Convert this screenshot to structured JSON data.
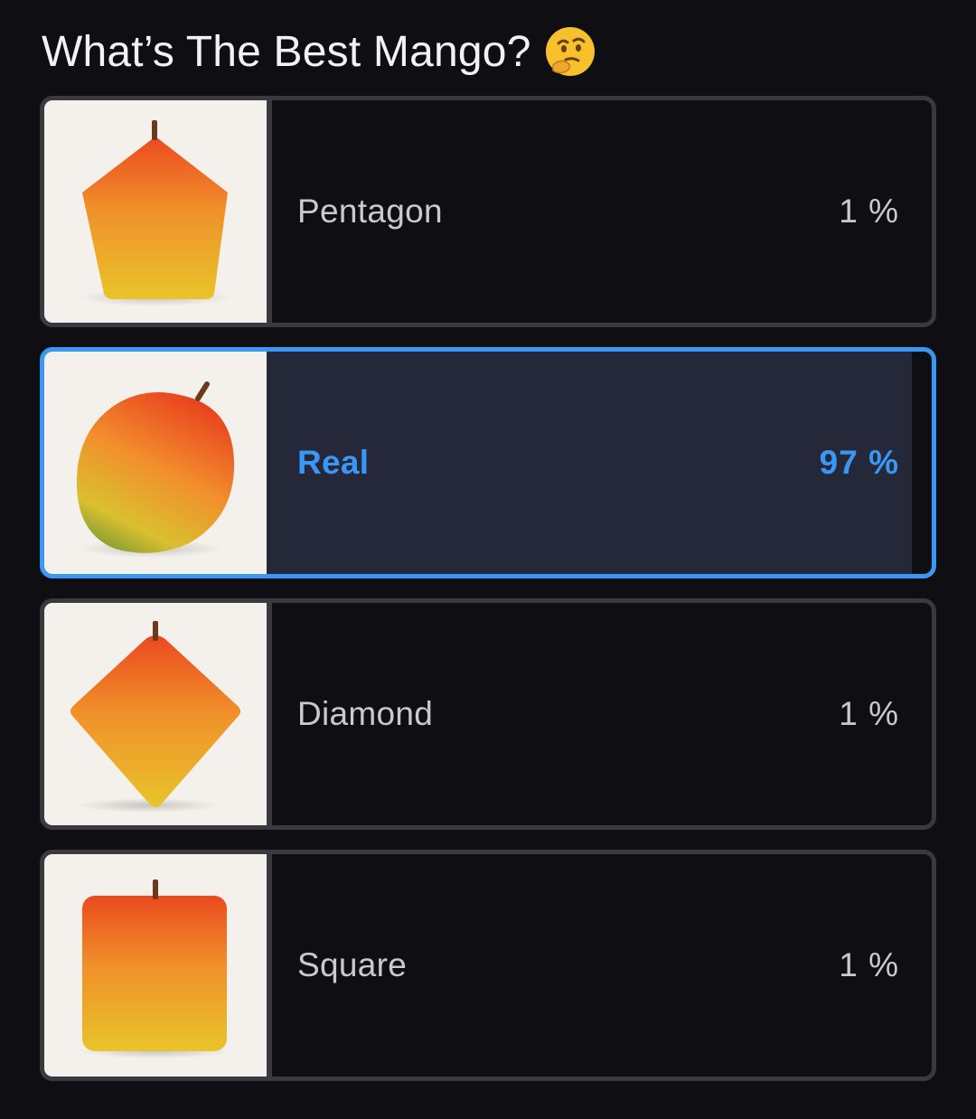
{
  "poll": {
    "title": "What’s The Best Mango?",
    "title_emoji": "thinking-face-icon",
    "accent_color": "#3b97f5",
    "options": [
      {
        "label": "Pentagon",
        "percent": "1 %",
        "share": 0.01,
        "selected": false,
        "image": "pentagon-mango-image"
      },
      {
        "label": "Real",
        "percent": "97 %",
        "share": 0.97,
        "selected": true,
        "image": "real-mango-image"
      },
      {
        "label": "Diamond",
        "percent": "1 %",
        "share": 0.01,
        "selected": false,
        "image": "diamond-mango-image"
      },
      {
        "label": "Square",
        "percent": "1 %",
        "share": 0.01,
        "selected": false,
        "image": "square-mango-image"
      }
    ]
  }
}
